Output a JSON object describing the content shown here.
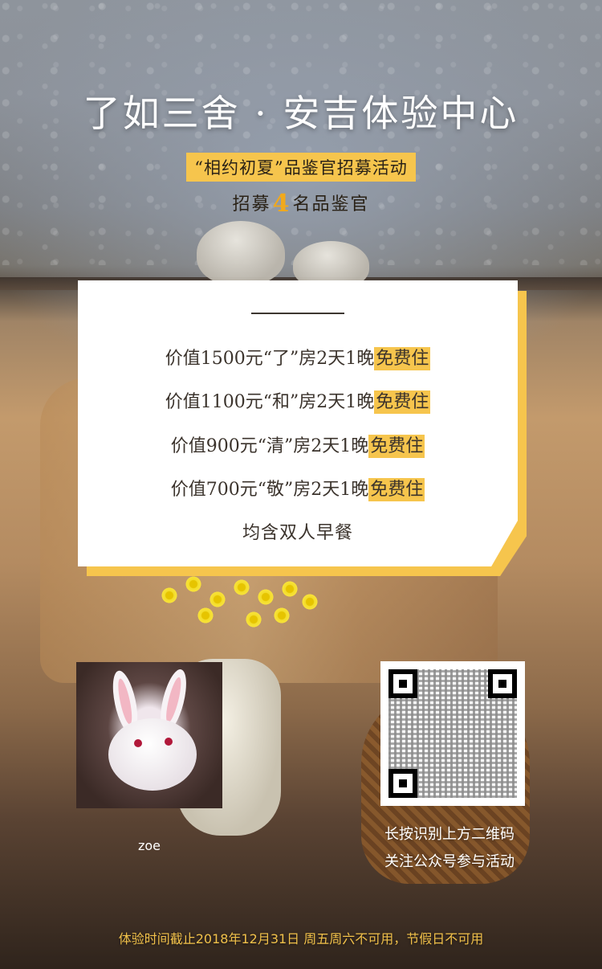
{
  "header": {
    "title": "了如三舍 · 安吉体验中心",
    "subtitle": "“相约初夏”品鉴官招募活动",
    "recruit_prefix": "招募",
    "recruit_number": "4",
    "recruit_suffix": "名品鉴官"
  },
  "card": {
    "offers": [
      {
        "text": "价值1500元“了”房2天1晚",
        "highlight": "免费住"
      },
      {
        "text": "价值1100元“和”房2天1晚",
        "highlight": "免费住"
      },
      {
        "text": "价值900元“清”房2天1晚",
        "highlight": "免费住"
      },
      {
        "text": "价值700元“敬”房2天1晚",
        "highlight": "免费住"
      }
    ],
    "breakfast": "均含双人早餐"
  },
  "avatar": {
    "name": "zoe"
  },
  "qr": {
    "line1": "长按识别上方二维码",
    "line2": "关注公众号参与活动"
  },
  "footer": {
    "note": "体验时间截止2018年12月31日 周五周六不可用，节假日不可用"
  },
  "colors": {
    "accent_yellow": "#f6c54d",
    "number_orange": "#f1a91c",
    "footer_text": "#f1c14a"
  }
}
